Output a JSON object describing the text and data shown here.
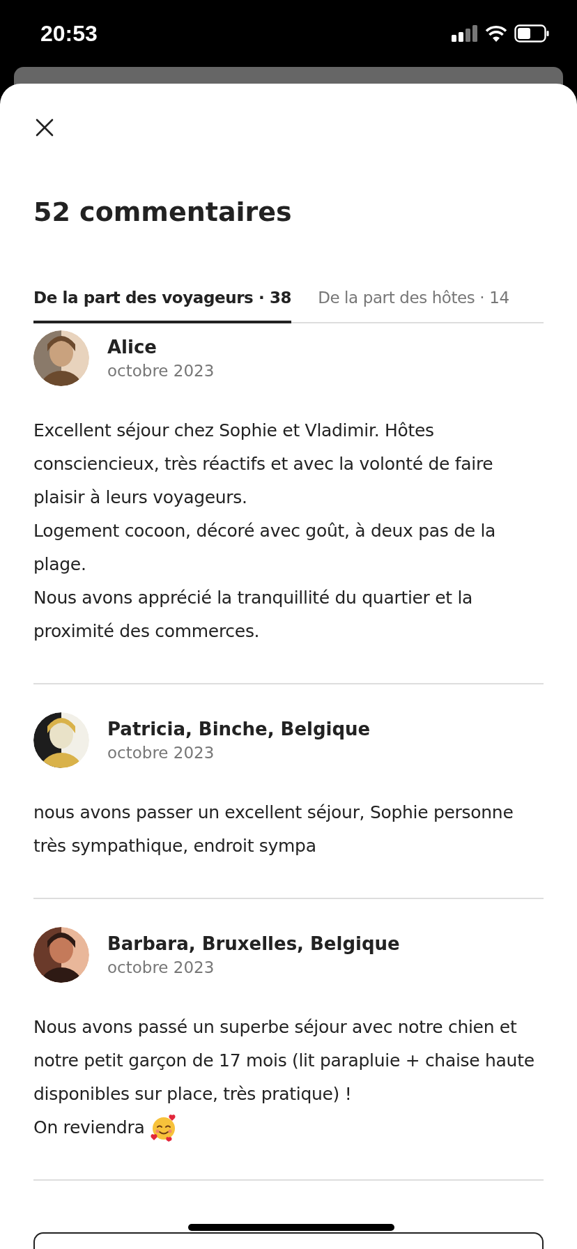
{
  "status_bar": {
    "time": "20:53"
  },
  "sheet": {
    "title": "52 commentaires"
  },
  "tabs": [
    {
      "label": "De la part des voyageurs · 38",
      "selected": true
    },
    {
      "label": "De la part des hôtes · 14",
      "selected": false
    }
  ],
  "reviews": [
    {
      "name": "Alice",
      "date": "octobre 2023",
      "avatar": {
        "kind": "picture"
      },
      "paragraphs": [
        "Excellent séjour chez Sophie et Vladimir. Hôtes consciencieux, très réactifs et avec la volonté de faire plaisir à leurs voyageurs.",
        "Logement cocoon, décoré avec goût, à deux pas de la plage.",
        "Nous avons apprécié la tranquillité du quartier et la proximité des commerces."
      ],
      "ends_with_emoji": false
    },
    {
      "name": "Patricia, Binche, Belgique",
      "date": "octobre 2023",
      "avatar": {
        "kind": "picture"
      },
      "paragraphs": [
        "nous avons passer un excellent séjour, Sophie personne très sympathique, endroit sympa"
      ],
      "ends_with_emoji": false
    },
    {
      "name": "Barbara, Bruxelles, Belgique",
      "date": "octobre 2023",
      "avatar": {
        "kind": "picture"
      },
      "paragraphs": [
        "Nous avons passé un superbe séjour avec notre chien et notre petit garçon de 17 mois (lit parapluie + chaise haute disponibles sur place, très pratique) !",
        "On reviendra"
      ],
      "ends_with_emoji": true
    }
  ]
}
